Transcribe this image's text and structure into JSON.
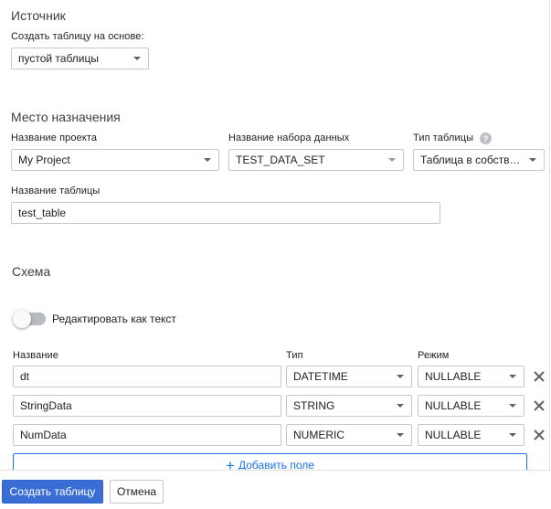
{
  "source": {
    "title": "Источник",
    "create_based_on_label": "Создать таблицу на основе:",
    "create_based_on_value": "пустой таблицы"
  },
  "destination": {
    "title": "Место назначения",
    "project_label": "Название проекта",
    "project_value": "My Project",
    "dataset_label": "Название набора данных",
    "dataset_value": "TEST_DATA_SET",
    "table_type_label": "Тип таблицы",
    "table_type_value": "Таблица в собстве...",
    "table_name_label": "Название таблицы",
    "table_name_value": "test_table"
  },
  "schema": {
    "title": "Схема",
    "edit_as_text_label": "Редактировать как текст",
    "col_name": "Название",
    "col_type": "Тип",
    "col_mode": "Режим",
    "fields": [
      {
        "name": "dt",
        "type": "DATETIME",
        "mode": "NULLABLE"
      },
      {
        "name": "StringData",
        "type": "STRING",
        "mode": "NULLABLE"
      },
      {
        "name": "NumData",
        "type": "NUMERIC",
        "mode": "NULLABLE"
      }
    ],
    "add_field_label": "Добавить поле"
  },
  "footer": {
    "create_label": "Создать таблицу",
    "cancel_label": "Отмена"
  },
  "colors": {
    "accent": "#1a73e8",
    "primary_button": "#3b6ed4"
  }
}
